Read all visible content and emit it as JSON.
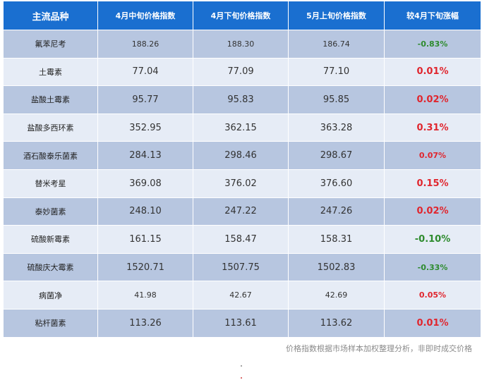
{
  "table": {
    "headers": [
      "主流品种",
      "4月中旬价格指数",
      "4月下旬价格指数",
      "5月上旬价格指数",
      "较4月下旬涨幅"
    ],
    "rows": [
      {
        "name": "氟苯尼考",
        "mid_apr": "188.26",
        "late_apr": "188.30",
        "early_may": "186.74",
        "change": "-0.83%",
        "direction": "down",
        "small": true
      },
      {
        "name": "土霉素",
        "mid_apr": "77.04",
        "late_apr": "77.09",
        "early_may": "77.10",
        "change": "0.01%",
        "direction": "up",
        "small": false
      },
      {
        "name": "盐酸土霉素",
        "mid_apr": "95.77",
        "late_apr": "95.83",
        "early_may": "95.85",
        "change": "0.02%",
        "direction": "up",
        "small": false
      },
      {
        "name": "盐酸多西环素",
        "mid_apr": "352.95",
        "late_apr": "362.15",
        "early_may": "363.28",
        "change": "0.31%",
        "direction": "up",
        "small": false
      },
      {
        "name": "酒石酸泰乐菌素",
        "mid_apr": "284.13",
        "late_apr": "298.46",
        "early_may": "298.67",
        "change": "0.07%",
        "direction": "up",
        "small": false,
        "small_change": true
      },
      {
        "name": "替米考星",
        "mid_apr": "369.08",
        "late_apr": "376.02",
        "early_may": "376.60",
        "change": "0.15%",
        "direction": "up",
        "small": false
      },
      {
        "name": "泰妙菌素",
        "mid_apr": "248.10",
        "late_apr": "247.22",
        "early_may": "247.26",
        "change": "0.02%",
        "direction": "up",
        "small": false
      },
      {
        "name": "硫酸新霉素",
        "mid_apr": "161.15",
        "late_apr": "158.47",
        "early_may": "158.31",
        "change": "-0.10%",
        "direction": "down",
        "small": false
      },
      {
        "name": "硫酸庆大霉素",
        "mid_apr": "1520.71",
        "late_apr": "1507.75",
        "early_may": "1502.83",
        "change": "-0.33%",
        "direction": "down",
        "small": false,
        "small_change": true
      },
      {
        "name": "病菌净",
        "mid_apr": "41.98",
        "late_apr": "42.67",
        "early_may": "42.69",
        "change": "0.05%",
        "direction": "up",
        "small": true
      },
      {
        "name": "粘杆菌素",
        "mid_apr": "113.26",
        "late_apr": "113.61",
        "early_may": "113.62",
        "change": "0.01%",
        "direction": "up",
        "small": false
      }
    ]
  },
  "footnote": "价格指数根据市场样本加权整理分析，非即时成交价格",
  "colors": {
    "header_bg": "#1a6fd0",
    "row_odd": "#b7c6e0",
    "row_even": "#e6ecf6",
    "up": "#e0262e",
    "down": "#2e8b2e"
  }
}
